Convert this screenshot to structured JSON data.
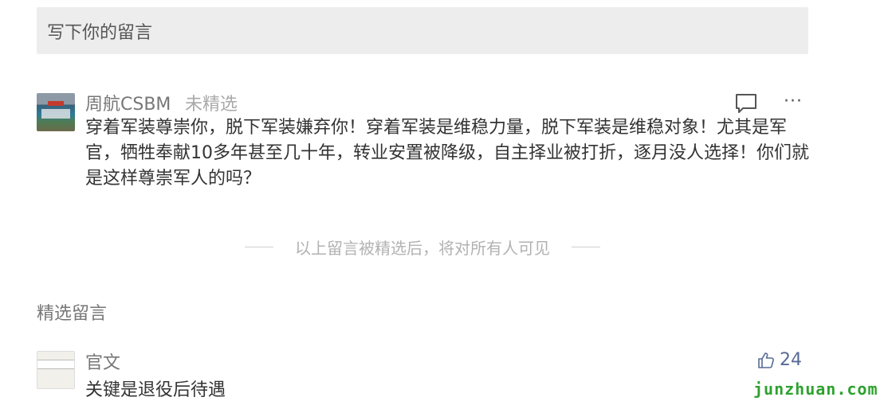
{
  "compose": {
    "placeholder": "写下你的留言"
  },
  "comments": [
    {
      "nickname": "周航CSBM",
      "status": "未精选",
      "text": "穿着军装尊崇你，脱下军装嫌弃你！穿着军装是维稳力量，脱下军装是维稳对象！尤其是军官，牺牲奉献10多年甚至几十年，转业安置被降级，自主择业被打折，逐月没人选择！你们就是这样尊崇军人的吗？",
      "reply_icon": "comment-bubble-icon",
      "more_icon": "more-dots-icon",
      "more_label": "···"
    }
  ],
  "notice": "以上留言被精选后，将对所有人可见",
  "featured": {
    "title": "精选留言",
    "items": [
      {
        "nickname": "官文",
        "text": "关键是退役后待遇",
        "likes": "24",
        "like_icon": "thumbs-up-icon"
      }
    ]
  },
  "watermark": "junzhuan.com",
  "colors": {
    "input_bg": "#ededed",
    "link_blue": "#576b95",
    "watermark_green": "#2ea12e"
  }
}
